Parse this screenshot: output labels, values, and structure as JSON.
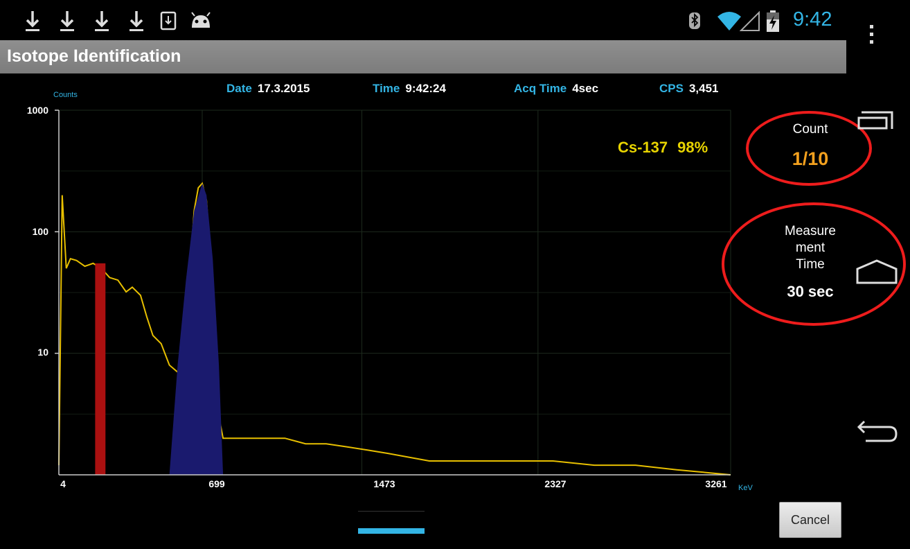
{
  "status_bar": {
    "time": "9:42",
    "notification_icons": [
      "download-icon",
      "download-icon",
      "download-icon",
      "download-icon",
      "download-box-icon",
      "android-icon"
    ],
    "system_icons": [
      "bluetooth-icon",
      "wifi-icon",
      "signal-icon",
      "battery-charging-icon"
    ]
  },
  "title_bar": {
    "title": "Isotope Identification"
  },
  "info_row": {
    "date_label": "Date",
    "date_value": "17.3.2015",
    "time_label": "Time",
    "time_value": "9:42:24",
    "acq_label": "Acq Time",
    "acq_value": "4sec",
    "cps_label": "CPS",
    "cps_value": "3,451"
  },
  "chart_data": {
    "type": "area",
    "title": "",
    "ylabel": "Counts",
    "xlabel": "KeV",
    "y_scale": "log",
    "y_ticks": [
      "1000",
      "100",
      "10"
    ],
    "x_ticks": [
      "4",
      "699",
      "1473",
      "2327",
      "3261"
    ],
    "xlim": [
      4,
      3261
    ],
    "ylim": [
      1,
      1000
    ],
    "grid": true,
    "series": [
      {
        "color": "#e8c000",
        "x": [
          4,
          20,
          40,
          60,
          90,
          130,
          170,
          210,
          250,
          290,
          330,
          360,
          400,
          430,
          460,
          500,
          540,
          580,
          610,
          640,
          660,
          680,
          699,
          720,
          740,
          760,
          780,
          800,
          830,
          900,
          1000,
          1100,
          1200,
          1300,
          1400,
          1500,
          1600,
          1800,
          2000,
          2200,
          2400,
          2600,
          2800,
          3000,
          3261
        ],
        "y": [
          1.2,
          200,
          50,
          60,
          58,
          52,
          55,
          50,
          42,
          40,
          32,
          35,
          30,
          20,
          14,
          12,
          8,
          7,
          10,
          50,
          150,
          230,
          250,
          180,
          60,
          10,
          3,
          2,
          2,
          2,
          2,
          2,
          1.8,
          1.8,
          1.7,
          1.6,
          1.5,
          1.3,
          1.3,
          1.3,
          1.3,
          1.2,
          1.2,
          1.1,
          1.0
        ]
      },
      {
        "color": "#1a1a6e",
        "x": [
          540,
          580,
          620,
          660,
          699,
          720,
          750,
          780,
          800
        ],
        "y": [
          1,
          8,
          40,
          150,
          250,
          200,
          60,
          8,
          1
        ]
      },
      {
        "color": "#aa1010",
        "x": [
          180,
          180,
          230,
          230
        ],
        "y": [
          1,
          55,
          55,
          1
        ]
      }
    ]
  },
  "identification": {
    "isotope": "Cs-137",
    "confidence": "98%",
    "color": "#e8d400"
  },
  "count_panel": {
    "label": "Count",
    "value": "1/10",
    "value_color": "#f2a01e"
  },
  "measurement_panel": {
    "label_line1": "Measure",
    "label_line2": "ment",
    "label_line3": "Time",
    "value": "30 sec"
  },
  "nav": {
    "recent_apps": "recent-apps-icon",
    "home": "home-icon",
    "back": "back-icon"
  },
  "cancel_button": {
    "label": "Cancel"
  },
  "accent_color": "#33b5e5",
  "highlight_color": "#ee1c1c"
}
